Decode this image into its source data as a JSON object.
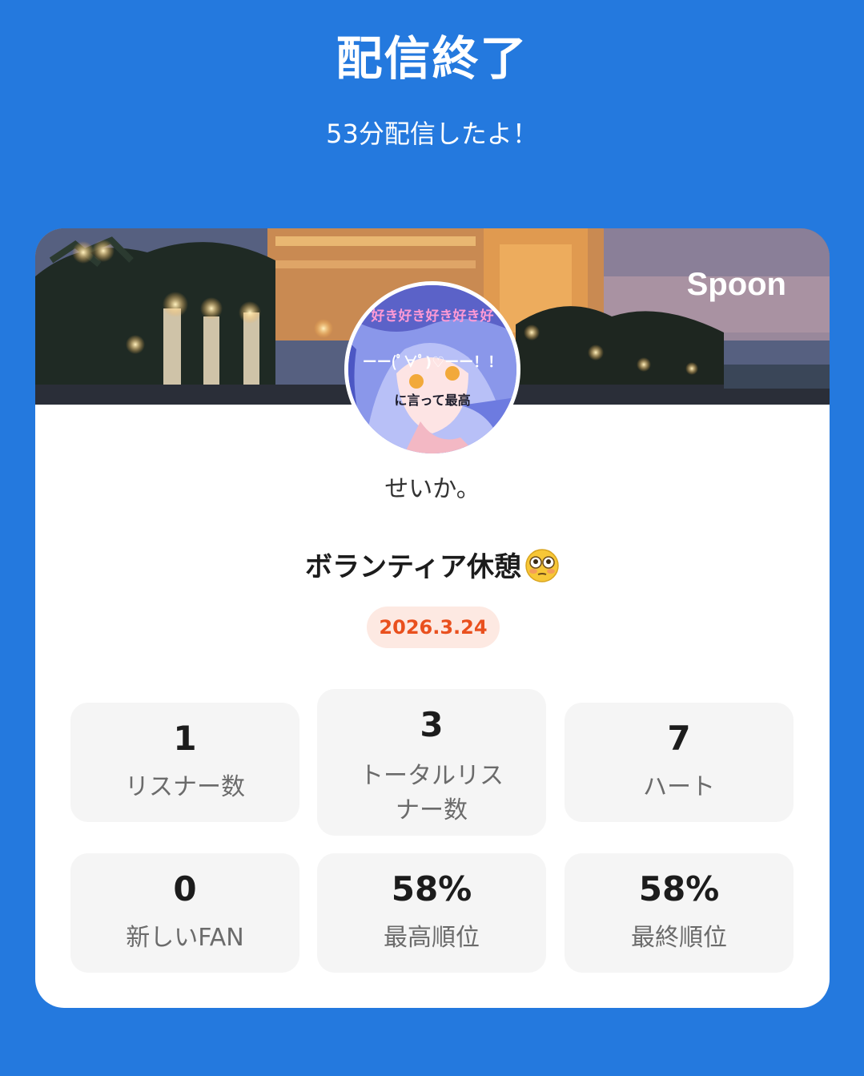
{
  "header": {
    "title": "配信終了",
    "subtitle": "53分配信したよ！"
  },
  "card": {
    "brand": "Spoon",
    "avatar_overlay": {
      "line1": "好き好き好き好き好",
      "line2": "ーー(ﾟ∀ﾟ)♡ーー！！",
      "line3": "に言って最高"
    },
    "username": "せいか。",
    "stream_title": "ボランティア休憩",
    "stream_title_emoji": "flushed-face-emoji",
    "date": "2026.3.24",
    "colors": {
      "background": "#2479de",
      "date_badge_bg": "#fde9e2",
      "date_badge_text": "#e9501e",
      "stat_bg": "#f5f5f5"
    },
    "stats": [
      {
        "value": "1",
        "label": "リスナー数"
      },
      {
        "value": "3",
        "label": "トータルリスナー数"
      },
      {
        "value": "7",
        "label": "ハート"
      },
      {
        "value": "0",
        "label": "新しいFAN"
      },
      {
        "value": "58%",
        "label": "最高順位"
      },
      {
        "value": "58%",
        "label": "最終順位"
      }
    ]
  }
}
